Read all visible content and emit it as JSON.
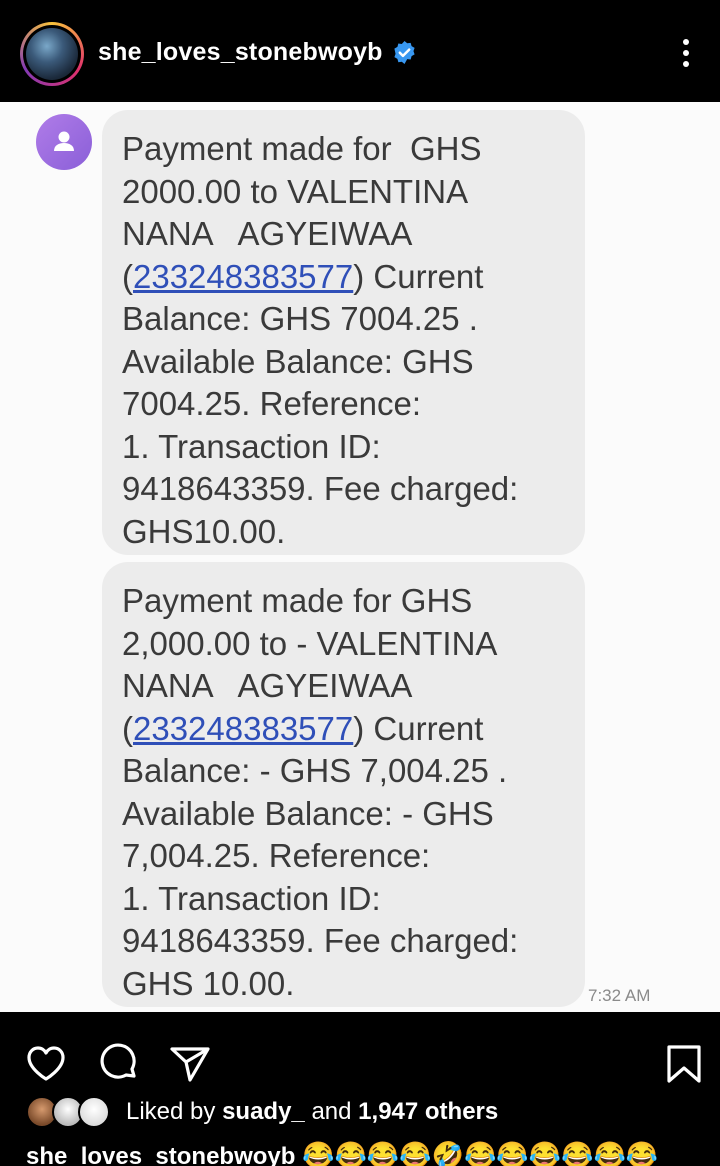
{
  "header": {
    "username": "she_loves_stonebwoyb",
    "verified": true
  },
  "sms": {
    "messages": [
      {
        "lines": [
          "Payment made for  GHS",
          "2000.00 to VALENTINA",
          "NANA   AGYEIWAA",
          {
            "pre": "(",
            "link": "233248383577",
            "post": ") Current"
          },
          "Balance: GHS 7004.25 .",
          "Available Balance: GHS",
          "7004.25. Reference:",
          "1. Transaction ID:",
          "9418643359. Fee charged:",
          "GHS10.00."
        ]
      },
      {
        "lines": [
          "Payment made for GHS",
          "2,000.00 to - VALENTINA",
          "NANA   AGYEIWAA",
          {
            "pre": "(",
            "link": "233248383577",
            "post": ") Current"
          },
          "Balance: - GHS 7,004.25 .",
          "Available Balance: - GHS",
          "7,004.25. Reference:",
          "1. Transaction ID:",
          "9418643359. Fee charged:",
          "GHS 10.00."
        ]
      }
    ],
    "timestamp": "7:32 AM"
  },
  "post": {
    "liked_by_prefix": "Liked by ",
    "liked_by_user": "suady_",
    "liked_by_middle": " and ",
    "liked_by_count": "1,947 others",
    "caption_user": "she_loves_stonebwoyb",
    "caption_emojis": "😂😂😂😂🤣😂😂😂😂😂😂"
  },
  "icons": [
    "verified-badge-icon",
    "more-options-icon",
    "contact-avatar-icon",
    "heart-icon",
    "comment-icon",
    "share-icon",
    "bookmark-icon"
  ],
  "colors": {
    "verified": "#3897f0",
    "link": "#2f4fb8",
    "bubble": "#ececec",
    "contact_icon": "#9b6ee0"
  }
}
